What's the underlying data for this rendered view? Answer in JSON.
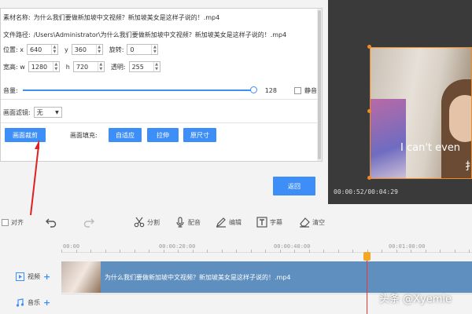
{
  "properties": {
    "material_name_label": "素材名称:",
    "material_name_value": "为什么我们要做新加坡中文视频？新加坡美女是这样子说的！.mp4",
    "file_path_label": "文件路径:",
    "file_path_value": "/Users\\Administrator\\为什么我们要做新加坡中文视频？新加坡美女是这样子说的！.mp4",
    "position_label": "位置: x",
    "x_value": "640",
    "y_label": "y",
    "y_value": "360",
    "rotation_label": "旋转:",
    "rotation_value": "0",
    "size_label": "宽高: w",
    "w_value": "1280",
    "h_label": "h",
    "h_value": "720",
    "opacity_label": "透明:",
    "opacity_value": "255",
    "volume_label": "音量:",
    "volume_value": "128",
    "mute_label": "静音",
    "filter_label": "画面滤镜:",
    "filter_value": "无",
    "crop_button": "画面裁剪",
    "fill_label": "画面填充:",
    "fill_options": [
      "自适应",
      "拉伸",
      "原尺寸"
    ],
    "back_button": "返回"
  },
  "preview": {
    "subtitle_line1": "I can't even",
    "subtitle_line2": "扌",
    "timecode": "00:00:52/00:04:29"
  },
  "toolbar": {
    "align_label": "对齐",
    "split_label": "分割",
    "dub_label": "配音",
    "edit_label": "编辑",
    "subtitle_label": "字幕",
    "clear_label": "清空"
  },
  "timeline": {
    "ruler_labels": [
      "00:00",
      "00:00:20:00",
      "00:00:40:00",
      "00:01:00:00"
    ],
    "video_track_label": "视频",
    "music_track_label": "音乐",
    "clip_title": "为什么我们要做新加坡中文视频？新加坡美女是这样子说的！.mp4"
  },
  "watermark": "头条 @Xyemie",
  "colors": {
    "accent": "#3e8ef7",
    "clip": "#5f8fbf",
    "playhead": "#ee3333",
    "handle": "#f08c22"
  }
}
